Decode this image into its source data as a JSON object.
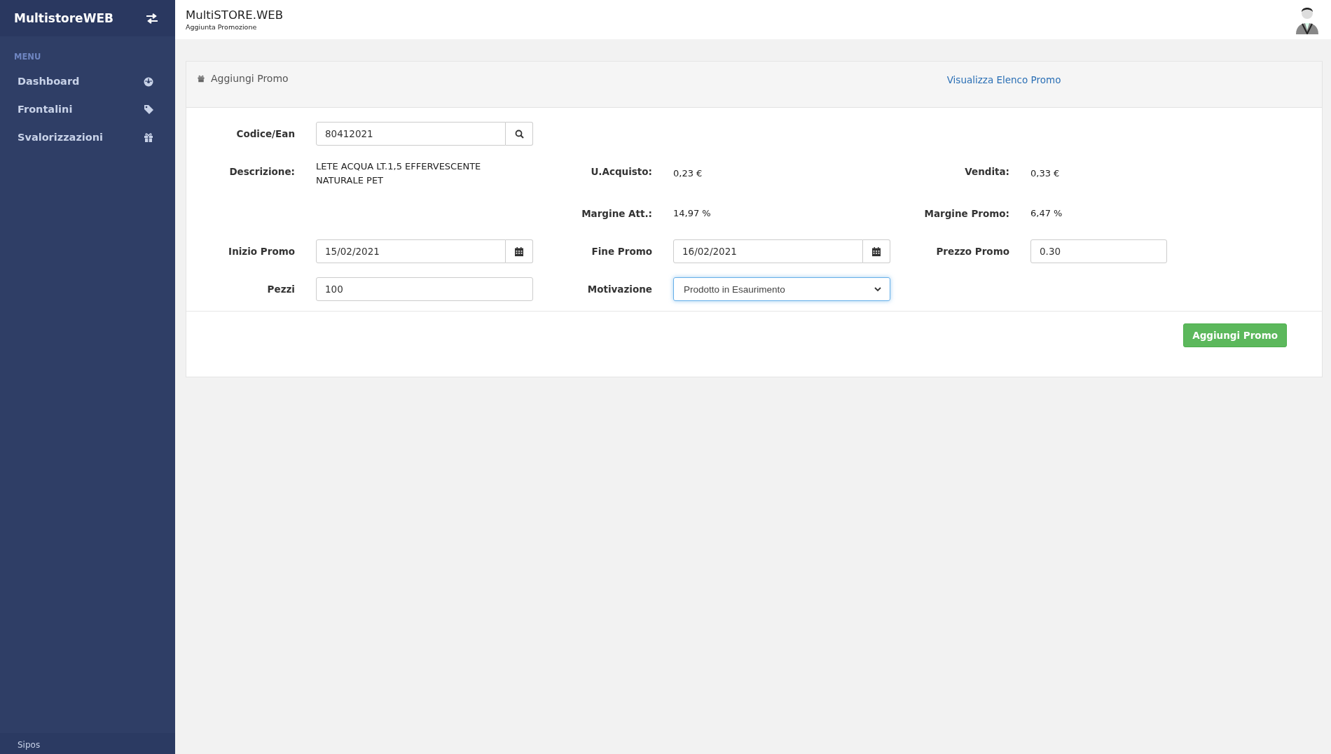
{
  "sidebar": {
    "brand": "MultistoreWEB",
    "section": "MENU",
    "items": [
      {
        "label": "Dashboard"
      },
      {
        "label": "Frontalini"
      },
      {
        "label": "Svalorizzazioni"
      }
    ],
    "footer": "Sipos"
  },
  "header": {
    "title": "MultiSTORE.WEB",
    "subtitle": "Aggiunta Promozione"
  },
  "panel": {
    "title": "Aggiungi Promo",
    "link": "Visualizza Elenco Promo",
    "rows": [
      {
        "left": {
          "label": "Codice/Ean",
          "kind": "search",
          "value": "80412021"
        }
      },
      {
        "left": {
          "label": "Descrizione:",
          "kind": "text",
          "value": "LETE ACQUA LT.1,5 EFFERVESCENTE NATURALE PET"
        },
        "middle": {
          "label": "U.Acquisto:",
          "kind": "text",
          "value": "0,23 €"
        },
        "right": {
          "label": "Vendita:",
          "kind": "text",
          "value": "0,33 €"
        }
      },
      {
        "middle": {
          "label": "Margine Att.:",
          "kind": "text",
          "value": "14,97 %"
        },
        "right": {
          "label": "Margine Promo:",
          "kind": "text",
          "value": "6,47 %"
        }
      },
      {
        "left": {
          "label": "Inizio Promo",
          "kind": "date",
          "value": "15/02/2021"
        },
        "middle": {
          "label": "Fine Promo",
          "kind": "date",
          "value": "16/02/2021"
        },
        "right": {
          "label": "Prezzo Promo",
          "kind": "input",
          "value": "0.30"
        }
      },
      {
        "left": {
          "label": "Pezzi",
          "kind": "input",
          "value": "100"
        },
        "middle": {
          "label": "Motivazione",
          "kind": "select",
          "value": "Prodotto in Esaurimento",
          "focused": true
        }
      }
    ],
    "button": "Aggiungi Promo"
  }
}
